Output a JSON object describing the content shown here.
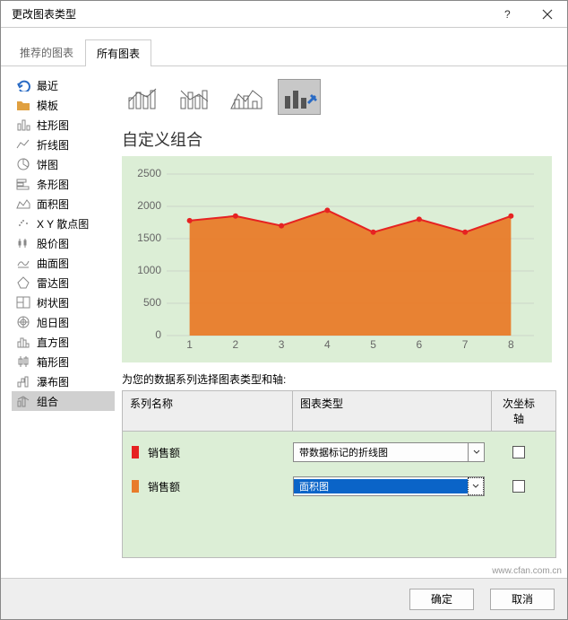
{
  "window": {
    "title": "更改图表类型"
  },
  "tabs": {
    "recommended": "推荐的图表",
    "all": "所有图表"
  },
  "sidebar": {
    "items": [
      {
        "label": "最近"
      },
      {
        "label": "模板"
      },
      {
        "label": "柱形图"
      },
      {
        "label": "折线图"
      },
      {
        "label": "饼图"
      },
      {
        "label": "条形图"
      },
      {
        "label": "面积图"
      },
      {
        "label": "X Y 散点图"
      },
      {
        "label": "股价图"
      },
      {
        "label": "曲面图"
      },
      {
        "label": "雷达图"
      },
      {
        "label": "树状图"
      },
      {
        "label": "旭日图"
      },
      {
        "label": "直方图"
      },
      {
        "label": "箱形图"
      },
      {
        "label": "瀑布图"
      },
      {
        "label": "组合"
      }
    ]
  },
  "subtitle": "自定义组合",
  "series_instruction": "为您的数据系列选择图表类型和轴:",
  "series_header": {
    "name": "系列名称",
    "type": "图表类型",
    "axis": "次坐标轴"
  },
  "series": [
    {
      "marker_color": "#e62222",
      "name": "销售额",
      "type": "带数据标记的折线图",
      "secondary": false
    },
    {
      "marker_color": "#e87b2a",
      "name": "销售额",
      "type": "面积图",
      "secondary": false
    }
  ],
  "buttons": {
    "ok": "确定",
    "cancel": "取消"
  },
  "watermark": "www.cfan.com.cn",
  "chart_data": {
    "type": "combo",
    "title": "",
    "xlabel": "",
    "ylabel": "",
    "y_ticks": [
      0,
      500,
      1000,
      1500,
      2000,
      2500
    ],
    "ylim": [
      0,
      2500
    ],
    "categories": [
      "1",
      "2",
      "3",
      "4",
      "5",
      "6",
      "7",
      "8"
    ],
    "series": [
      {
        "name": "销售额",
        "type": "line_markers",
        "color": "#e62222",
        "values": [
          1780,
          1850,
          1700,
          1940,
          1600,
          1800,
          1600,
          1850
        ]
      },
      {
        "name": "销售额",
        "type": "area",
        "color": "#e87b2a",
        "values": [
          1780,
          1850,
          1700,
          1940,
          1600,
          1800,
          1600,
          1850
        ]
      }
    ],
    "legend": false,
    "grid": true
  }
}
